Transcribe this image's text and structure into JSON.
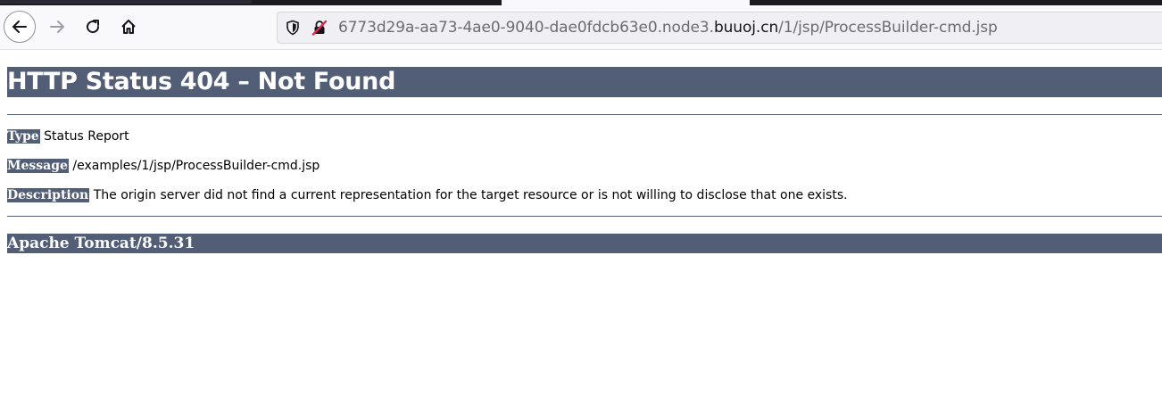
{
  "browser": {
    "url_prefix": "6773d29a-aa73-4ae0-9040-dae0fdcb63e0.node3.",
    "url_domain": "buuoj.cn",
    "url_path": "/1/jsp/ProcessBuilder-cmd.jsp"
  },
  "page": {
    "title": "HTTP Status 404 – Not Found",
    "rows": [
      {
        "label": "Type",
        "value": "Status Report"
      },
      {
        "label": "Message",
        "value": "/examples/1/jsp/ProcessBuilder-cmd.jsp"
      },
      {
        "label": "Description",
        "value": "The origin server did not find a current representation for the target resource or is not willing to disclose that one exists."
      }
    ],
    "footer": "Apache Tomcat/8.5.31"
  },
  "colors": {
    "header_bg": "#525d76",
    "header_text": "#ffffff"
  }
}
